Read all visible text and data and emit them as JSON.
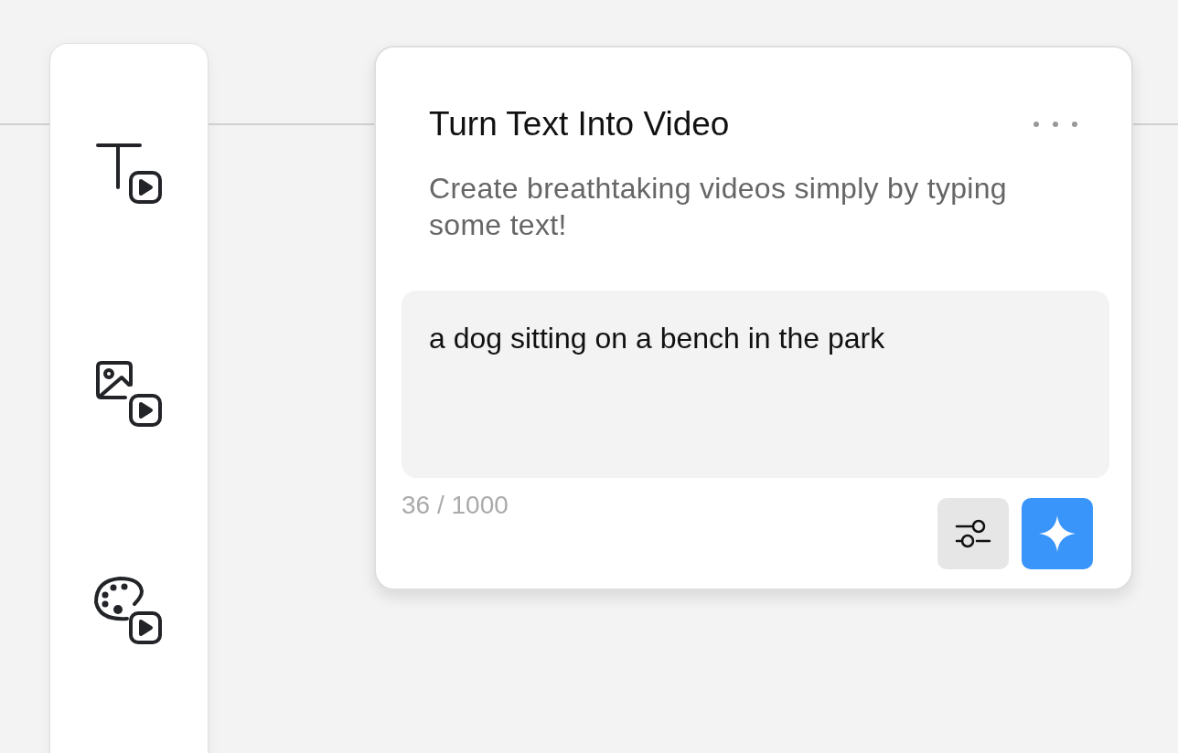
{
  "sidebar": {
    "tools": [
      {
        "kind": "text-to-video"
      },
      {
        "kind": "image-to-video"
      },
      {
        "kind": "style-to-video"
      }
    ]
  },
  "card": {
    "title": "Turn Text Into Video",
    "description": "Create breathtaking videos simply by typing some text!",
    "prompt": {
      "value": "a dog sitting on a bench in the park"
    },
    "counter": "36 / 1000"
  }
}
